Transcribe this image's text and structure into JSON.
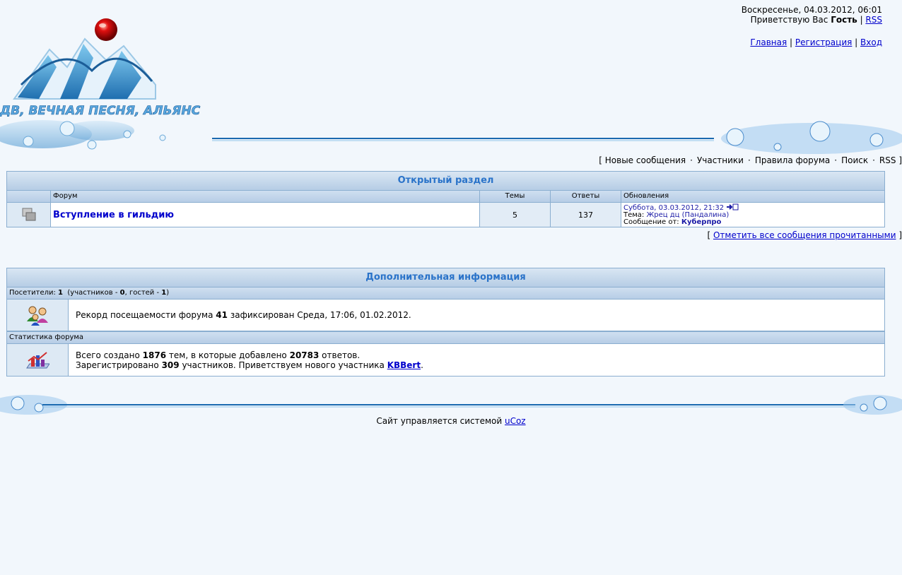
{
  "header": {
    "logo_text": "ДВ, ВЕЧНАЯ ПЕСНЯ, АЛЬЯНС",
    "datetime": "Воскресенье, 04.03.2012, 06:01",
    "greeting_prefix": "Приветствую Вас",
    "greeting_user": "Гость",
    "rss": "RSS",
    "nav": {
      "home": "Главная",
      "register": "Регистрация",
      "login": "Вход"
    }
  },
  "forum_nav": {
    "items": [
      "Новые сообщения",
      "Участники",
      "Правила форума",
      "Поиск",
      "RSS"
    ]
  },
  "open_section": {
    "title": "Открытый раздел",
    "columns": {
      "forum": "Форум",
      "topics": "Темы",
      "replies": "Ответы",
      "updates": "Обновления"
    },
    "forums": [
      {
        "name": "Вступление в гильдию",
        "topics": "5",
        "replies": "137",
        "last_date": "Суббота, 03.03.2012, 21:32",
        "topic_label": "Тема:",
        "topic_title": "Жрец дц (Пандалина)",
        "msg_label": "Сообщение от:",
        "author": "Куберпро",
        "icon": "forum-read-icon"
      }
    ],
    "mark_read": "Отметить все сообщения прочитанными"
  },
  "info_section": {
    "title": "Дополнительная информация",
    "visitors_label": "Посетители:",
    "visitors_total": "1",
    "visitors_members_label": "(участников -",
    "visitors_members": "0",
    "visitors_guests_label": ", гостей -",
    "visitors_guests": "1",
    "record_prefix": "Рекорд посещаемости форума",
    "record_value": "41",
    "record_suffix": "зафиксирован Среда, 17:06, 01.02.2012.",
    "stats_label": "Статистика форума",
    "stats_line1_a": "Всего создано",
    "stats_topics": "1876",
    "stats_line1_b": "тем, в которые добавлено",
    "stats_replies": "20783",
    "stats_line1_c": "ответов.",
    "stats_line2_a": "Зарегистрировано",
    "stats_users": "309",
    "stats_line2_b": "участников. Приветствуем нового участника",
    "newest_user": "KBBert"
  },
  "footer": {
    "text": "Сайт управляется системой",
    "link": "uCoz"
  },
  "colors": {
    "accent": "#2a73c9",
    "link": "#0000cc",
    "border": "#8aaed0"
  }
}
